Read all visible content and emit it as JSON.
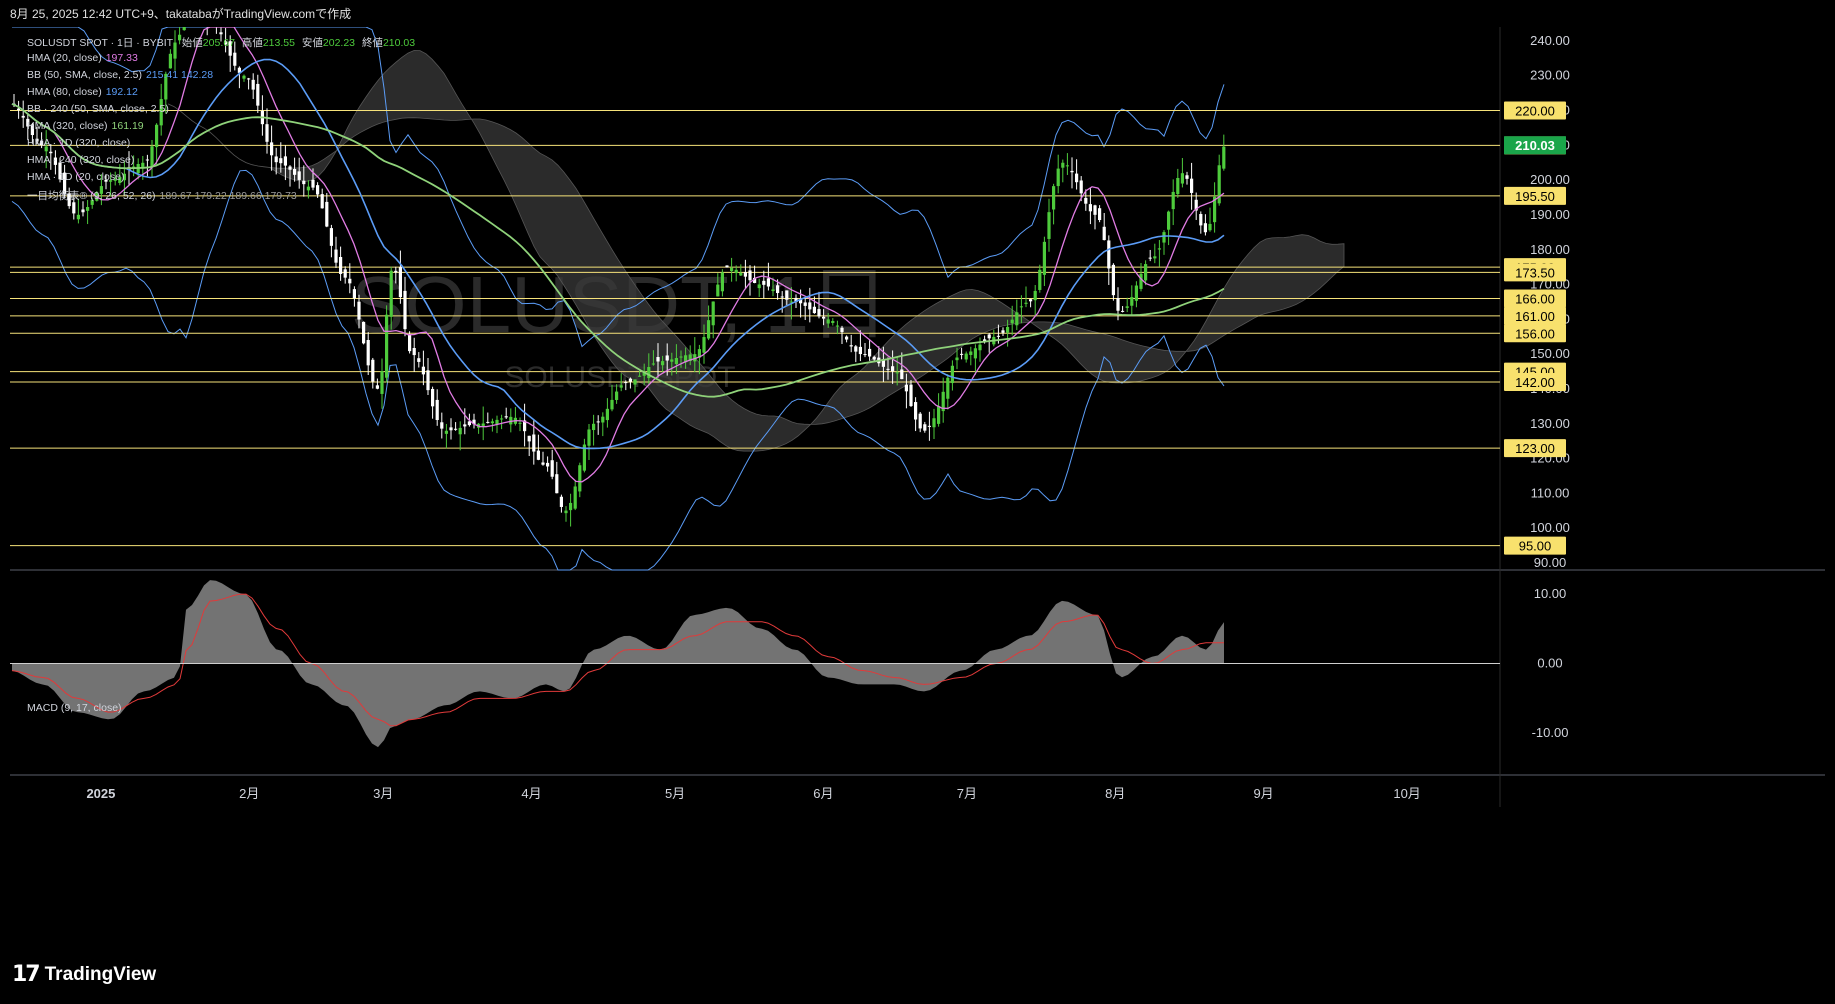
{
  "header": {
    "text": "8月 25, 2025 12:42 UTC+9、takatabaがTradingView.comで作成"
  },
  "watermark": {
    "line1": "SOLUSDT, 1日",
    "line2": "SOLUSDT SPOT"
  },
  "legend": {
    "symbol": "SOLUSDT SPOT · 1日 · BYBIT",
    "ohlc_labels": [
      "始値",
      "高値",
      "安値",
      "終値"
    ],
    "ohlc_values": [
      "205.67",
      "213.55",
      "202.23",
      "210.03"
    ],
    "indicators": [
      {
        "label": "HMA (20, close)",
        "value": "197.33",
        "color": "#e17ce4"
      },
      {
        "label": "BB (50, SMA, close, 2.5)",
        "value": "215.41  142.28",
        "color": "#5b9cf6"
      },
      {
        "label": "HMA (80, close)",
        "value": "192.12",
        "color": "#5b9cf6"
      },
      {
        "label": "BB · 240 (50, SMA, close, 2.5)",
        "value": "",
        "color": "#5b9cf6"
      },
      {
        "label": "HMA (320, close)",
        "value": "161.19",
        "color": "#8fd27a"
      },
      {
        "label": "HMA · 1D (320, close)",
        "value": "",
        "color": "#8fd27a"
      },
      {
        "label": "HMA · 240 (320, close)",
        "value": "",
        "color": "#8fd27a"
      },
      {
        "label": "HMA · 1D (20, close)",
        "value": "",
        "color": "#e17ce4"
      },
      {
        "label": "一目均衡表® (9, 26, 52, 26)",
        "value": "189.67  179.22  189.66  179.73",
        "color": "#9e9e9e"
      }
    ]
  },
  "macd_label": "MACD (9, 17, close)",
  "logo": {
    "mark": "17",
    "name": "TradingView"
  },
  "colors": {
    "background": "#000000",
    "level_line": "#f6e27a",
    "candle_up": "#4ecb3c",
    "candle_down": "#ffffff",
    "hma20": "#e17ce4",
    "hma80": "#5b9cf6",
    "hma320": "#8fd27a",
    "bb": "#5b9cf6",
    "cloud": "#3a3a3a",
    "macd_hist": "#808080",
    "macd_signal": "#e03a3a",
    "last_price_badge": "#1aa54a",
    "level_badge": "#f8e16d"
  },
  "chart_data": {
    "type": "candlestick",
    "title": "SOLUSDT, 1日",
    "price_axis": {
      "ticks": [
        240,
        230,
        220,
        210,
        200,
        190,
        180,
        170,
        160,
        150,
        140,
        130,
        120,
        110,
        100,
        90
      ],
      "tick_labels": [
        "240.00",
        "230.00",
        "220.00",
        "210.00",
        "200.00",
        "190.00",
        "180.00",
        "170.00",
        "160.00",
        "150.00",
        "140.00",
        "130.00",
        "120.00",
        "110.00",
        "100.00",
        "90.00"
      ],
      "ylim": [
        88,
        244
      ]
    },
    "levels": [
      220.0,
      210.0,
      195.5,
      175.0,
      173.5,
      166.0,
      161.0,
      156.0,
      145.0,
      142.0,
      123.0,
      95.0
    ],
    "level_labels": [
      "220.00",
      "210.00",
      "195.50",
      "175.00",
      "173.50",
      "166.00",
      "161.00",
      "156.00",
      "145.00",
      "142.00",
      "123.00",
      "95.00"
    ],
    "last_price": {
      "value": 210.03,
      "label": "210.03"
    },
    "time_axis": {
      "labels": [
        "2025",
        "2月",
        "3月",
        "4月",
        "5月",
        "6月",
        "7月",
        "8月",
        "9月",
        "10月"
      ],
      "dates": [
        "2025-01-01",
        "2025-02-01",
        "2025-03-01",
        "2025-04-01",
        "2025-05-01",
        "2025-06-01",
        "2025-07-01",
        "2025-08-01",
        "2025-09-01",
        "2025-10-01"
      ]
    },
    "close_series": {
      "dates": [
        "2024-12-13",
        "2024-12-20",
        "2024-12-27",
        "2025-01-03",
        "2025-01-10",
        "2025-01-17",
        "2025-01-19",
        "2025-01-24",
        "2025-01-31",
        "2025-02-07",
        "2025-02-14",
        "2025-02-21",
        "2025-02-28",
        "2025-03-03",
        "2025-03-07",
        "2025-03-14",
        "2025-03-21",
        "2025-03-28",
        "2025-04-04",
        "2025-04-08",
        "2025-04-14",
        "2025-04-21",
        "2025-04-28",
        "2025-05-05",
        "2025-05-12",
        "2025-05-19",
        "2025-05-26",
        "2025-06-02",
        "2025-06-09",
        "2025-06-16",
        "2025-06-22",
        "2025-06-30",
        "2025-07-07",
        "2025-07-14",
        "2025-07-21",
        "2025-07-28",
        "2025-08-02",
        "2025-08-09",
        "2025-08-15",
        "2025-08-20",
        "2025-08-24"
      ],
      "close": [
        222,
        210,
        190,
        200,
        205,
        240,
        255,
        245,
        230,
        205,
        198,
        172,
        140,
        175,
        150,
        128,
        130,
        132,
        118,
        105,
        130,
        142,
        148,
        150,
        175,
        170,
        165,
        160,
        150,
        145,
        128,
        150,
        155,
        165,
        205,
        190,
        162,
        178,
        202,
        185,
        210
      ]
    },
    "macd": {
      "ticks": [
        10,
        0,
        -10
      ],
      "tick_labels": [
        "10.00",
        "0.00",
        "-10.00"
      ],
      "ylim": [
        -16,
        13
      ],
      "hist": [
        -1,
        -3,
        -7,
        -8,
        -4,
        -2,
        8,
        12,
        10,
        2,
        -3,
        -6,
        -12,
        -9,
        -8,
        -6,
        -4,
        -5,
        -3,
        -4,
        2,
        4,
        2,
        7,
        8,
        5,
        2,
        -2,
        -3,
        -3,
        -4,
        -1,
        2,
        4,
        9,
        7,
        -2,
        1,
        4,
        2,
        6
      ],
      "signal": [
        -1,
        -2,
        -5,
        -7,
        -5,
        -3,
        2,
        9,
        10,
        5,
        0,
        -4,
        -8,
        -9,
        -8,
        -7,
        -5,
        -5,
        -4,
        -4,
        -1,
        2,
        2,
        4,
        6,
        6,
        4,
        1,
        -1,
        -2,
        -3,
        -2,
        0,
        2,
        6,
        7,
        2,
        0,
        2,
        3,
        3
      ]
    }
  }
}
